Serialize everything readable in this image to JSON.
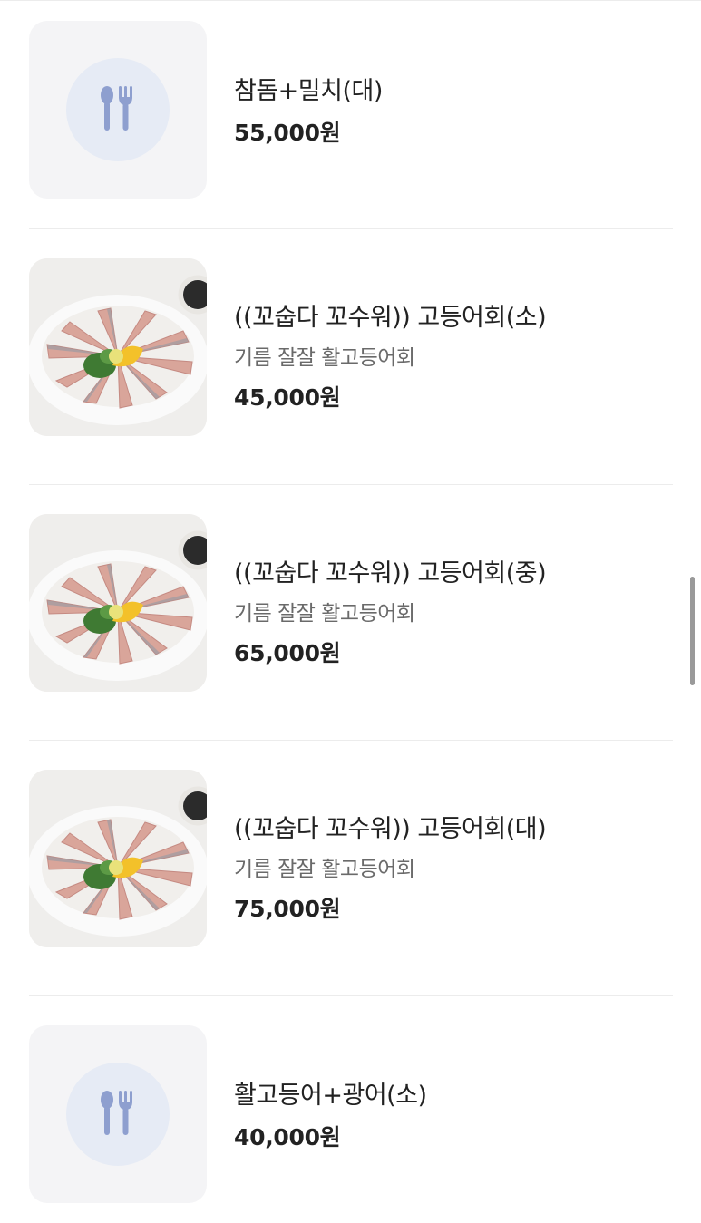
{
  "menu_items": [
    {
      "name": "참돔+밀치(대)",
      "description": "",
      "price": "55,000원",
      "image": "placeholder-fork-spoon-icon"
    },
    {
      "name": "((꼬숩다 꼬수워)) 고등어회(소)",
      "description": "기름 잘잘 활고등어회",
      "price": "45,000원",
      "image": "mackerel-sashimi-photo"
    },
    {
      "name": "((꼬숩다 꼬수워)) 고등어회(중)",
      "description": "기름 잘잘 활고등어회",
      "price": "65,000원",
      "image": "mackerel-sashimi-photo"
    },
    {
      "name": "((꼬숩다 꼬수워)) 고등어회(대)",
      "description": "기름 잘잘 활고등어회",
      "price": "75,000원",
      "image": "mackerel-sashimi-photo"
    },
    {
      "name": "활고등어+광어(소)",
      "description": "",
      "price": "40,000원",
      "image": "placeholder-fork-spoon-icon"
    }
  ],
  "colors": {
    "placeholder_bg": "#f4f4f6",
    "placeholder_circle": "#e6ebf5",
    "utensil_icon": "#8e9fcf"
  }
}
